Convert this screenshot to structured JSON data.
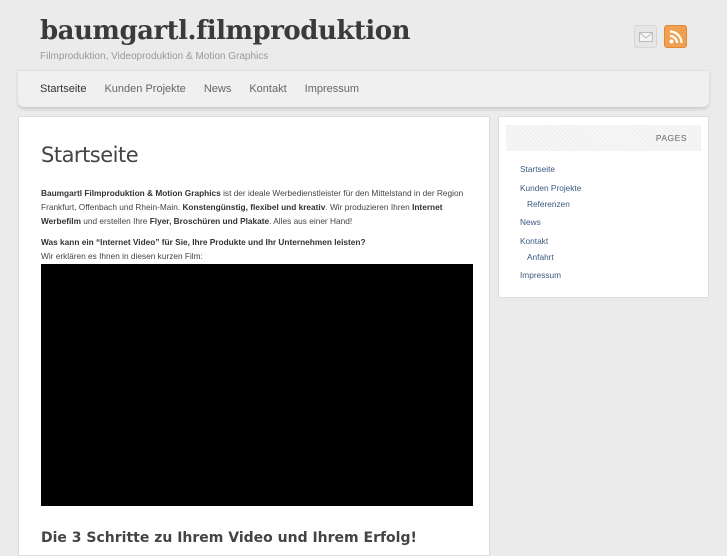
{
  "header": {
    "logo": "baumgartl.filmproduktion",
    "tagline": "Filmproduktion, Videoproduktion & Motion Graphics",
    "icons": [
      "mail-icon",
      "rss-icon"
    ]
  },
  "nav": [
    "Startseite",
    "Kunden Projekte",
    "News",
    "Kontakt",
    "Impressum"
  ],
  "main": {
    "title": "Startseite",
    "p1": [
      "Baumgartl Filmproduktion & Motion Graphics",
      " ist der ideale Werbedienstleister für den Mittelstand in der Region Frankfurt, Offenbach und Rhein-Main. ",
      "Konstengünstig, flexibel und kreativ",
      ". Wir produzieren Ihren ",
      "Internet Werbefilm",
      " und erstellen Ihre ",
      "Flyer, Broschüren und Plakate",
      ". Alles aus einer Hand!"
    ],
    "q": "Was kann ein “Internet Video” für Sie, Ihre Produkte und Ihr Unternehmen leisten?",
    "q2": "Wir erklären es Ihnen in diesen kurzen Film:",
    "h2": "Die 3 Schritte zu Ihrem Video und Ihrem Erfolg!"
  },
  "sidebar": {
    "heading": "PAGES",
    "items": [
      "Startseite",
      "Kunden Projekte",
      "Referenzen",
      "News",
      "Kontakt",
      "Anfahrt",
      "Impressum"
    ]
  }
}
